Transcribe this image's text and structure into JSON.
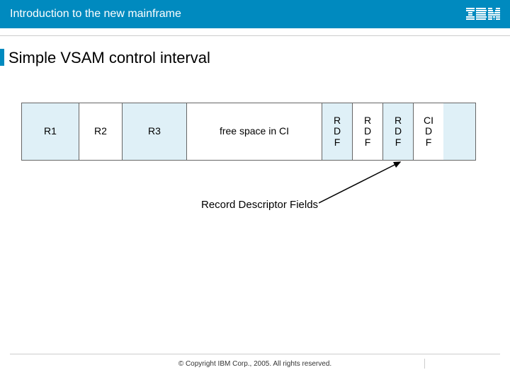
{
  "header": {
    "title": "Introduction to the new mainframe",
    "logo_name": "ibm-logo"
  },
  "slide": {
    "title": "Simple VSAM control interval"
  },
  "diagram": {
    "cells": {
      "r1": "R1",
      "r2": "R2",
      "r3": "R3",
      "free": "free space in CI",
      "rdf": "R\nD\nF",
      "cidf": "CI\nD\nF"
    },
    "annotation": "Record Descriptor Fields"
  },
  "footer": {
    "copyright": "© Copyright IBM Corp., 2005. All rights reserved."
  }
}
